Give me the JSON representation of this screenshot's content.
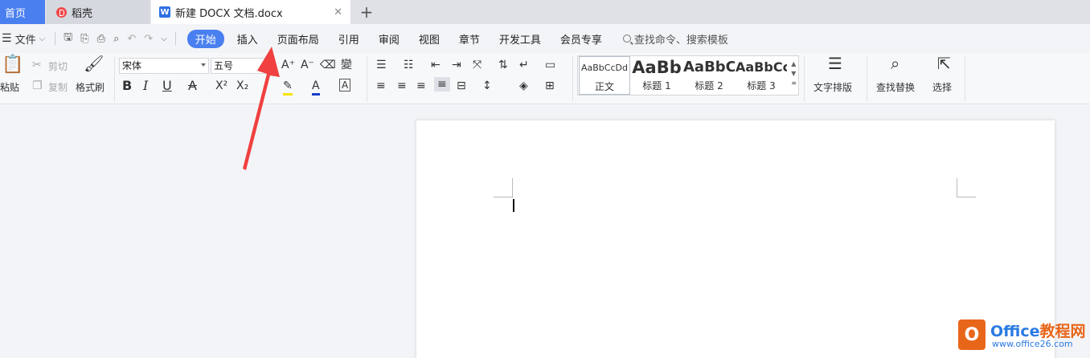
{
  "tabs": {
    "home": "首页",
    "daoke": "稻壳",
    "document": "新建 DOCX 文档.docx",
    "close": "✕",
    "add": "+"
  },
  "menubar": {
    "file": "文件",
    "tabs": [
      "开始",
      "插入",
      "页面布局",
      "引用",
      "审阅",
      "视图",
      "章节",
      "开发工具",
      "会员专享"
    ],
    "active_tab": "开始",
    "search": "查找命令、搜索模板"
  },
  "ribbon": {
    "paste": "粘贴",
    "cut": "剪切",
    "copy": "复制",
    "format_painter": "格式刷",
    "font_name": "宋体",
    "font_size": "五号",
    "bold": "B",
    "italic": "I",
    "underline": "U",
    "strike": "A",
    "superscript": "X²",
    "subscript": "X₂",
    "grow": "A⁺",
    "shrink": "A⁻",
    "font_color": "A",
    "char_border": "A",
    "styles": [
      {
        "sample": "AaBbCcDd",
        "label": "正文"
      },
      {
        "sample": "AaBb",
        "label": "标题 1"
      },
      {
        "sample": "AaBbC",
        "label": "标题 2"
      },
      {
        "sample": "AaBbCc",
        "label": "标题 3"
      }
    ],
    "text_layout": "文字排版",
    "find_replace": "查找替换",
    "select": "选择"
  },
  "watermark": {
    "brand_main": "Office",
    "brand_accent": "教程网",
    "url": "www.office26.com",
    "logo_letter": "O"
  },
  "colors": {
    "accent": "#4a7ff0",
    "arrow": "#f04040",
    "watermark_orange": "#e8661a",
    "watermark_blue": "#2a7ae2"
  }
}
